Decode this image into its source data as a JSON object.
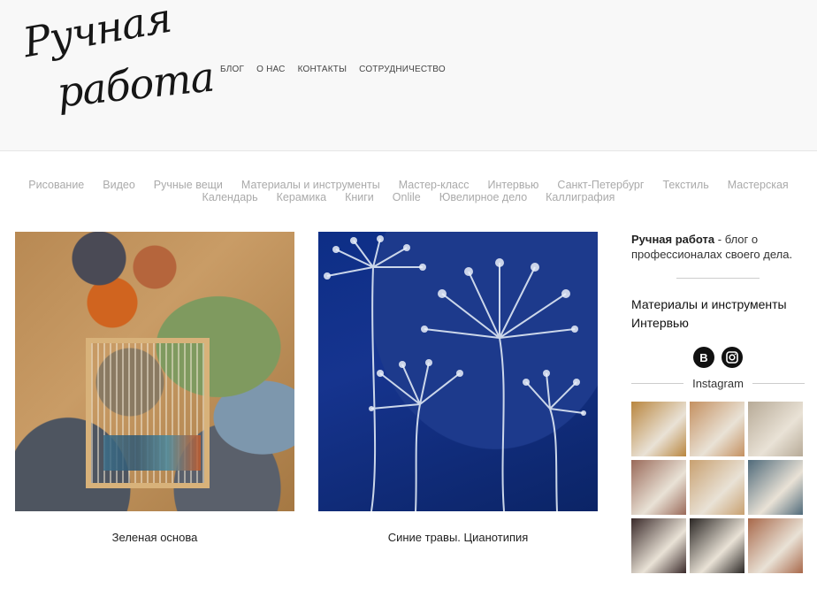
{
  "logo": {
    "line1": "Ручная",
    "line2": "работа"
  },
  "topnav": [
    "БЛОГ",
    "О НАС",
    "КОНТАКТЫ",
    "СОТРУДНИЧЕСТВО"
  ],
  "categories": {
    "row1": [
      "Рисование",
      "Видео",
      "Ручные вещи",
      "Материалы и инструменты",
      "Мастер-класс",
      "Интервью",
      "Санкт-Петербург",
      "Текстиль",
      "Мастерская"
    ],
    "row2": [
      "Календарь",
      "Керамика",
      "Книги",
      "Onlile",
      "Ювелирное дело",
      "Каллиграфия"
    ]
  },
  "posts": [
    {
      "title": "Зеленая основа"
    },
    {
      "title": "Синие травы. Цианотипия"
    }
  ],
  "sidebar": {
    "about_bold": "Ручная работа",
    "about_rest": " - блог о профессионалах своего дела.",
    "links": [
      "Материалы и инструменты",
      "Интервью"
    ],
    "social": {
      "vk": "В",
      "instagram_icon": "instagram-icon"
    },
    "instagram_label": "Instagram",
    "thumb_colors": [
      "#b9863f",
      "#c49060",
      "#b7aa97",
      "#9a6a5a",
      "#c8a070",
      "#4f6a7a",
      "#3a2a2a",
      "#2a2624",
      "#a8684a"
    ]
  }
}
